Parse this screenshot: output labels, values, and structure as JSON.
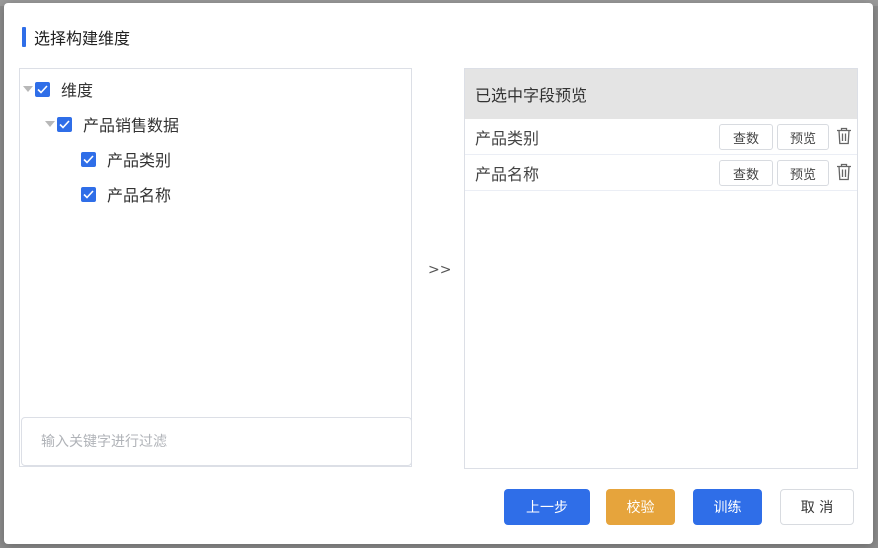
{
  "dialog": {
    "title": "选择构建维度",
    "separator": ">>"
  },
  "tree": {
    "root": {
      "label": "维度",
      "checked": true
    },
    "group": {
      "label": "产品销售数据",
      "checked": true
    },
    "leaves": [
      {
        "label": "产品类别",
        "checked": true
      },
      {
        "label": "产品名称",
        "checked": true
      }
    ]
  },
  "filter": {
    "placeholder": "输入关键字进行过滤",
    "value": ""
  },
  "selected": {
    "header": "已选中字段预览",
    "rows": [
      {
        "name": "产品类别",
        "query_label": "查数",
        "preview_label": "预览",
        "delete_icon": "trash-icon"
      },
      {
        "name": "产品名称",
        "query_label": "查数",
        "preview_label": "预览",
        "delete_icon": "trash-icon"
      }
    ]
  },
  "footer": {
    "prev_label": "上一步",
    "validate_label": "校验",
    "train_label": "训练",
    "cancel_label": "取 消"
  },
  "colors": {
    "primary": "#2f6ee8",
    "warning": "#e6a43c",
    "header_bg": "#e4e4e4"
  }
}
